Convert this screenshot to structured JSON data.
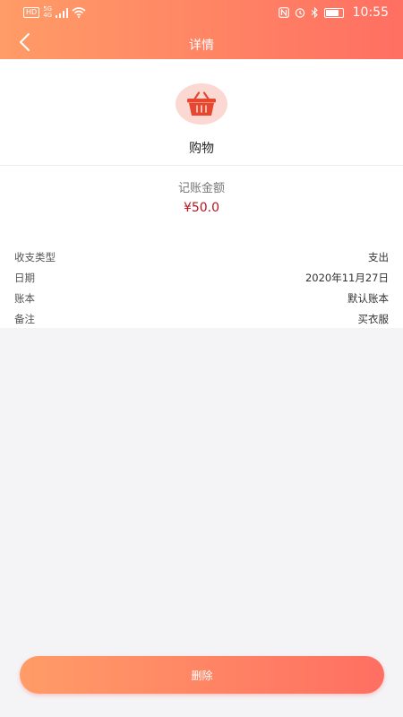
{
  "status_bar": {
    "hd": "HD",
    "network_top": "5G",
    "network_bottom": "4G",
    "nfc": "N",
    "time": "10:55",
    "battery_level": 0.8
  },
  "nav": {
    "title": "详情"
  },
  "category": {
    "name": "购物",
    "icon": "shopping-basket-icon"
  },
  "amount": {
    "label": "记账金额",
    "value": "¥50.0"
  },
  "details": [
    {
      "label": "收支类型",
      "value": "支出"
    },
    {
      "label": "日期",
      "value": "2020年11月27日"
    },
    {
      "label": "账本",
      "value": "默认账本"
    },
    {
      "label": "备注",
      "value": "买衣服"
    }
  ],
  "actions": {
    "delete_label": "删除"
  },
  "colors": {
    "gradient_start": "#ff9c67",
    "gradient_end": "#ff6f62",
    "amount": "#b4151e",
    "icon_bg": "#fbd9d2",
    "icon": "#e8462f"
  }
}
